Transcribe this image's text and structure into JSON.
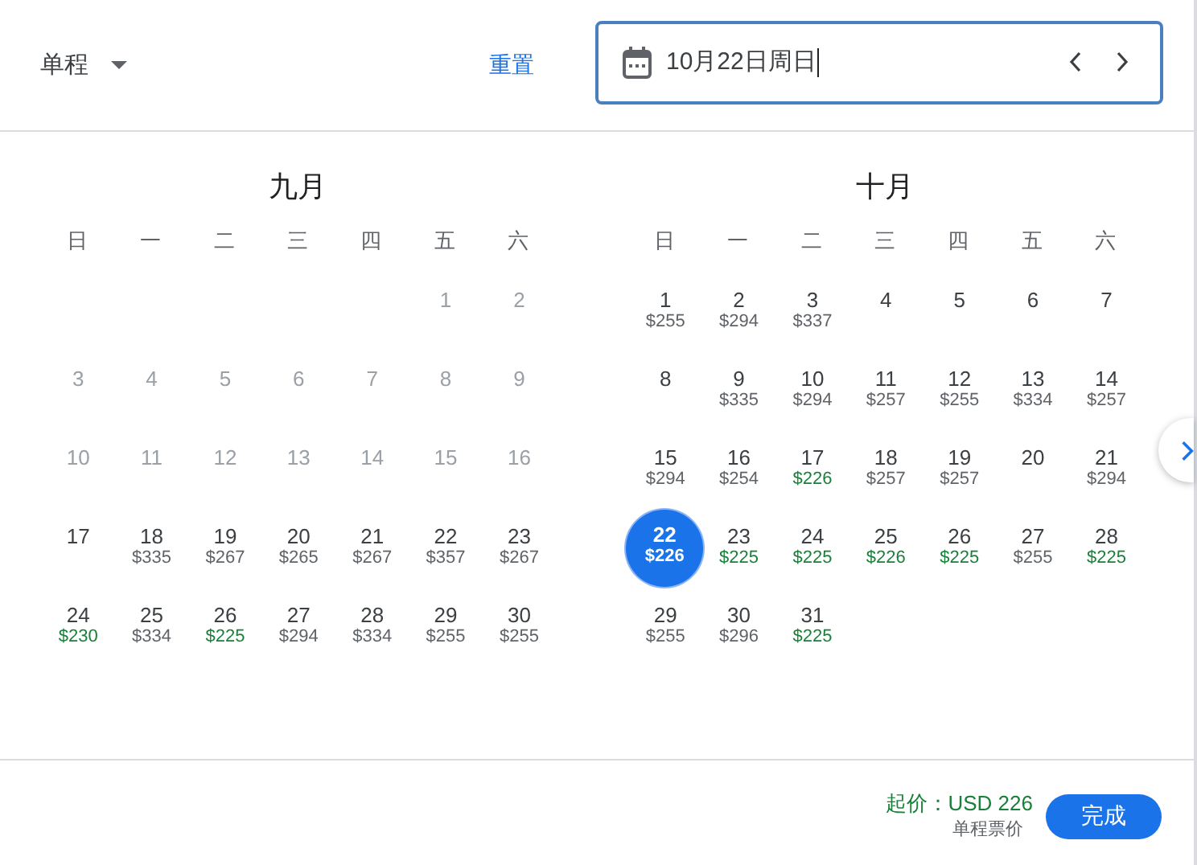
{
  "trip_type": {
    "label": "单程"
  },
  "reset_link": "重置",
  "date_field": {
    "value": "10月22日周日"
  },
  "months": [
    {
      "title": "九月",
      "weekdays": [
        "日",
        "一",
        "二",
        "三",
        "四",
        "五",
        "六"
      ],
      "days": [
        {
          "kind": "blank"
        },
        {
          "kind": "blank"
        },
        {
          "kind": "blank"
        },
        {
          "kind": "blank"
        },
        {
          "kind": "blank"
        },
        {
          "kind": "day",
          "day": "1",
          "disabled": true,
          "selected": false
        },
        {
          "kind": "day",
          "day": "2",
          "disabled": true,
          "selected": false
        },
        {
          "kind": "day",
          "day": "3",
          "disabled": true,
          "selected": false
        },
        {
          "kind": "day",
          "day": "4",
          "disabled": true,
          "selected": false
        },
        {
          "kind": "day",
          "day": "5",
          "disabled": true,
          "selected": false
        },
        {
          "kind": "day",
          "day": "6",
          "disabled": true,
          "selected": false
        },
        {
          "kind": "day",
          "day": "7",
          "disabled": true,
          "selected": false
        },
        {
          "kind": "day",
          "day": "8",
          "disabled": true,
          "selected": false
        },
        {
          "kind": "day",
          "day": "9",
          "disabled": true,
          "selected": false
        },
        {
          "kind": "day",
          "day": "10",
          "disabled": true,
          "selected": false
        },
        {
          "kind": "day",
          "day": "11",
          "disabled": true,
          "selected": false
        },
        {
          "kind": "day",
          "day": "12",
          "disabled": true,
          "selected": false
        },
        {
          "kind": "day",
          "day": "13",
          "disabled": true,
          "selected": false
        },
        {
          "kind": "day",
          "day": "14",
          "disabled": true,
          "selected": false
        },
        {
          "kind": "day",
          "day": "15",
          "disabled": true,
          "selected": false
        },
        {
          "kind": "day",
          "day": "16",
          "disabled": true,
          "selected": false
        },
        {
          "kind": "day",
          "day": "17",
          "disabled": false,
          "selected": false
        },
        {
          "kind": "day",
          "day": "18",
          "price": "$335",
          "cheap": false,
          "disabled": false,
          "selected": false
        },
        {
          "kind": "day",
          "day": "19",
          "price": "$267",
          "cheap": false,
          "disabled": false,
          "selected": false
        },
        {
          "kind": "day",
          "day": "20",
          "price": "$265",
          "cheap": false,
          "disabled": false,
          "selected": false
        },
        {
          "kind": "day",
          "day": "21",
          "price": "$267",
          "cheap": false,
          "disabled": false,
          "selected": false
        },
        {
          "kind": "day",
          "day": "22",
          "price": "$357",
          "cheap": false,
          "disabled": false,
          "selected": false
        },
        {
          "kind": "day",
          "day": "23",
          "price": "$267",
          "cheap": false,
          "disabled": false,
          "selected": false
        },
        {
          "kind": "day",
          "day": "24",
          "price": "$230",
          "cheap": true,
          "disabled": false,
          "selected": false
        },
        {
          "kind": "day",
          "day": "25",
          "price": "$334",
          "cheap": false,
          "disabled": false,
          "selected": false
        },
        {
          "kind": "day",
          "day": "26",
          "price": "$225",
          "cheap": true,
          "disabled": false,
          "selected": false
        },
        {
          "kind": "day",
          "day": "27",
          "price": "$294",
          "cheap": false,
          "disabled": false,
          "selected": false
        },
        {
          "kind": "day",
          "day": "28",
          "price": "$334",
          "cheap": false,
          "disabled": false,
          "selected": false
        },
        {
          "kind": "day",
          "day": "29",
          "price": "$255",
          "cheap": false,
          "disabled": false,
          "selected": false
        },
        {
          "kind": "day",
          "day": "30",
          "price": "$255",
          "cheap": false,
          "disabled": false,
          "selected": false
        }
      ]
    },
    {
      "title": "十月",
      "weekdays": [
        "日",
        "一",
        "二",
        "三",
        "四",
        "五",
        "六"
      ],
      "days": [
        {
          "kind": "day",
          "day": "1",
          "price": "$255",
          "cheap": false,
          "disabled": false,
          "selected": false
        },
        {
          "kind": "day",
          "day": "2",
          "price": "$294",
          "cheap": false,
          "disabled": false,
          "selected": false
        },
        {
          "kind": "day",
          "day": "3",
          "price": "$337",
          "cheap": false,
          "disabled": false,
          "selected": false
        },
        {
          "kind": "day",
          "day": "4",
          "disabled": false,
          "selected": false
        },
        {
          "kind": "day",
          "day": "5",
          "disabled": false,
          "selected": false
        },
        {
          "kind": "day",
          "day": "6",
          "disabled": false,
          "selected": false
        },
        {
          "kind": "day",
          "day": "7",
          "disabled": false,
          "selected": false
        },
        {
          "kind": "day",
          "day": "8",
          "disabled": false,
          "selected": false
        },
        {
          "kind": "day",
          "day": "9",
          "price": "$335",
          "cheap": false,
          "disabled": false,
          "selected": false
        },
        {
          "kind": "day",
          "day": "10",
          "price": "$294",
          "cheap": false,
          "disabled": false,
          "selected": false
        },
        {
          "kind": "day",
          "day": "11",
          "price": "$257",
          "cheap": false,
          "disabled": false,
          "selected": false
        },
        {
          "kind": "day",
          "day": "12",
          "price": "$255",
          "cheap": false,
          "disabled": false,
          "selected": false
        },
        {
          "kind": "day",
          "day": "13",
          "price": "$334",
          "cheap": false,
          "disabled": false,
          "selected": false
        },
        {
          "kind": "day",
          "day": "14",
          "price": "$257",
          "cheap": false,
          "disabled": false,
          "selected": false
        },
        {
          "kind": "day",
          "day": "15",
          "price": "$294",
          "cheap": false,
          "disabled": false,
          "selected": false
        },
        {
          "kind": "day",
          "day": "16",
          "price": "$254",
          "cheap": false,
          "disabled": false,
          "selected": false
        },
        {
          "kind": "day",
          "day": "17",
          "price": "$226",
          "cheap": true,
          "disabled": false,
          "selected": false
        },
        {
          "kind": "day",
          "day": "18",
          "price": "$257",
          "cheap": false,
          "disabled": false,
          "selected": false
        },
        {
          "kind": "day",
          "day": "19",
          "price": "$257",
          "cheap": false,
          "disabled": false,
          "selected": false
        },
        {
          "kind": "day",
          "day": "20",
          "disabled": false,
          "selected": false
        },
        {
          "kind": "day",
          "day": "21",
          "price": "$294",
          "cheap": false,
          "disabled": false,
          "selected": false
        },
        {
          "kind": "day",
          "day": "22",
          "price": "$226",
          "cheap": true,
          "disabled": false,
          "selected": true
        },
        {
          "kind": "day",
          "day": "23",
          "price": "$225",
          "cheap": true,
          "disabled": false,
          "selected": false
        },
        {
          "kind": "day",
          "day": "24",
          "price": "$225",
          "cheap": true,
          "disabled": false,
          "selected": false
        },
        {
          "kind": "day",
          "day": "25",
          "price": "$226",
          "cheap": true,
          "disabled": false,
          "selected": false
        },
        {
          "kind": "day",
          "day": "26",
          "price": "$225",
          "cheap": true,
          "disabled": false,
          "selected": false
        },
        {
          "kind": "day",
          "day": "27",
          "price": "$255",
          "cheap": false,
          "disabled": false,
          "selected": false
        },
        {
          "kind": "day",
          "day": "28",
          "price": "$225",
          "cheap": true,
          "disabled": false,
          "selected": false
        },
        {
          "kind": "day",
          "day": "29",
          "price": "$255",
          "cheap": false,
          "disabled": false,
          "selected": false
        },
        {
          "kind": "day",
          "day": "30",
          "price": "$296",
          "cheap": false,
          "disabled": false,
          "selected": false
        },
        {
          "kind": "day",
          "day": "31",
          "price": "$225",
          "cheap": true,
          "disabled": false,
          "selected": false
        }
      ]
    }
  ],
  "footer": {
    "from_price": "起价：USD 226",
    "note": "单程票价",
    "done_button": "完成"
  }
}
